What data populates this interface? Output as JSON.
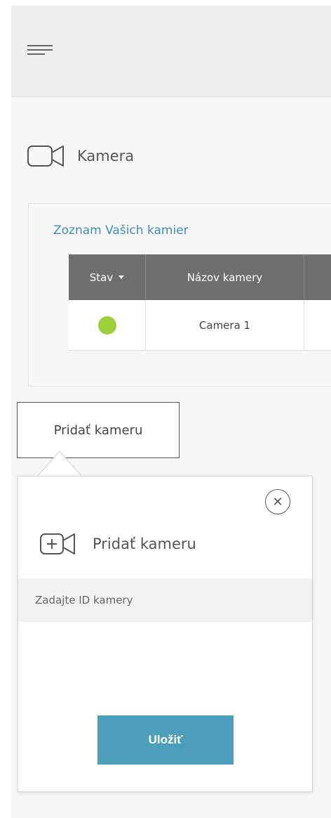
{
  "header": {
    "menu_icon": "hamburger-menu-icon"
  },
  "section": {
    "icon": "video-camera-icon",
    "title": "Kamera"
  },
  "camera_list": {
    "link": "Zoznam Vašich kamier",
    "columns": [
      "Stav",
      "Názov kamery",
      ""
    ],
    "rows": [
      {
        "status": "online",
        "status_color": "#9ccf3a",
        "name": "Camera 1"
      }
    ]
  },
  "add_camera": {
    "button_label": "Pridať kameru",
    "panel": {
      "icon": "add-video-camera-icon",
      "title": "Pridať kameru",
      "input_placeholder": "Zadajte ID kamery",
      "input_value": "",
      "save_label": "Uložiť",
      "close_icon": "close-icon"
    }
  },
  "colors": {
    "accent": "#4d9eba",
    "link": "#3a8fb5",
    "table_header": "#6e6e6e"
  }
}
